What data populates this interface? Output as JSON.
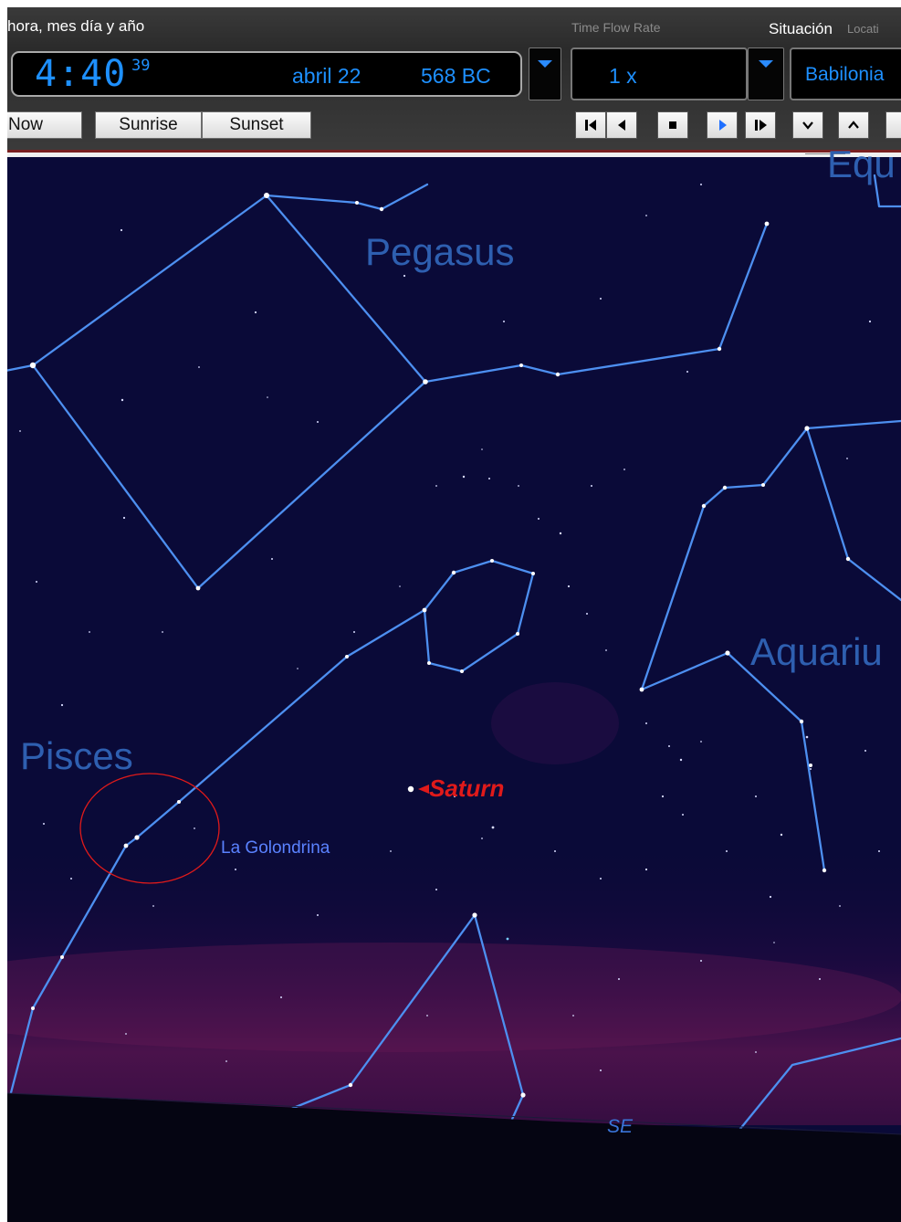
{
  "toolbar": {
    "datetime_label": "hora, mes día y año",
    "time_hm": "4:40",
    "time_sec": "39",
    "date_month_day": "abril 22",
    "date_year": "568 BC",
    "flow_rate_label": "Time Flow Rate",
    "flow_rate_value": "1 x",
    "location_label": "Situación",
    "location_label_en": "Locati",
    "location_value": "Babilonia",
    "buttons": {
      "now": "Now",
      "sunrise": "Sunrise",
      "sunset": "Sunset"
    },
    "playback_controls": [
      "step-back-icon",
      "reverse-icon",
      "stop-icon",
      "play-icon",
      "step-forward-icon"
    ],
    "zoom_controls": [
      "chevron-down-icon",
      "chevron-up-icon"
    ]
  },
  "sky": {
    "constellations": [
      "Pegasus",
      "Pisces",
      "Aquariu",
      "Equ"
    ],
    "planet_label": "Saturn",
    "annotation_label": "La Golondrina",
    "compass": "SE"
  },
  "colors": {
    "sky": "#0a0a38",
    "constellation_lines": "#4d8ff0",
    "constellation_labels": "#2e5fb0",
    "planet_label": "#e01a1a",
    "annotation": "#e01a1a",
    "lcd": "#1e90ff",
    "ground": "#050512"
  }
}
